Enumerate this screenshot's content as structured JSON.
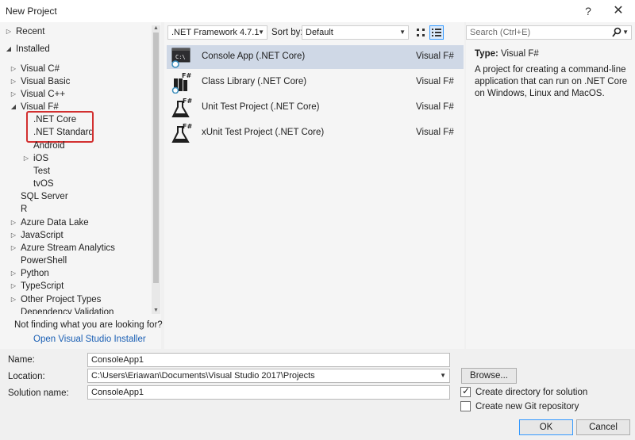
{
  "window": {
    "title": "New Project",
    "help_glyph": "?",
    "close_glyph": "✕"
  },
  "tree": {
    "recent": "Recent",
    "installed": "Installed",
    "items": [
      {
        "label": "Visual C#"
      },
      {
        "label": "Visual Basic"
      },
      {
        "label": "Visual C++"
      },
      {
        "label": "Visual F#"
      },
      {
        "label": ".NET Core"
      },
      {
        "label": ".NET Standard"
      },
      {
        "label": "Android"
      },
      {
        "label": "iOS"
      },
      {
        "label": "Test"
      },
      {
        "label": "tvOS"
      },
      {
        "label": "SQL Server"
      },
      {
        "label": "R"
      },
      {
        "label": "Azure Data Lake"
      },
      {
        "label": "JavaScript"
      },
      {
        "label": "Azure Stream Analytics"
      },
      {
        "label": "PowerShell"
      },
      {
        "label": "Python"
      },
      {
        "label": "TypeScript"
      },
      {
        "label": "Other Project Types"
      },
      {
        "label": "Dependency Validation"
      }
    ],
    "not_finding": "Not finding what you are looking for?",
    "installer_link": "Open Visual Studio Installer"
  },
  "toolbar": {
    "framework": ".NET Framework 4.7.1",
    "sort_by_label": "Sort by:",
    "sort_by_value": "Default"
  },
  "templates": [
    {
      "name": "Console App (.NET Core)",
      "lang": "Visual F#"
    },
    {
      "name": "Class Library (.NET Core)",
      "lang": "Visual F#"
    },
    {
      "name": "Unit Test Project (.NET Core)",
      "lang": "Visual F#"
    },
    {
      "name": "xUnit Test Project (.NET Core)",
      "lang": "Visual F#"
    }
  ],
  "details": {
    "search_placeholder": "Search (Ctrl+E)",
    "type_label": "Type:",
    "type_value": "Visual F#",
    "description": "A project for creating a command-line application that can run on .NET Core on Windows, Linux and MacOS."
  },
  "form": {
    "name_label": "Name:",
    "name_value": "ConsoleApp1",
    "location_label": "Location:",
    "location_value": "C:\\Users\\Eriawan\\Documents\\Visual Studio 2017\\Projects",
    "solution_label": "Solution name:",
    "solution_value": "ConsoleApp1",
    "browse": "Browse...",
    "create_dir": "Create directory for solution",
    "create_dir_checked": true,
    "create_git": "Create new Git repository",
    "create_git_checked": false,
    "ok": "OK",
    "cancel": "Cancel"
  },
  "colors": {
    "highlight_box": "#d23030",
    "selected_row": "#cfd8e6",
    "link": "#1a5fb4",
    "fsharp_blue": "#378bba"
  }
}
